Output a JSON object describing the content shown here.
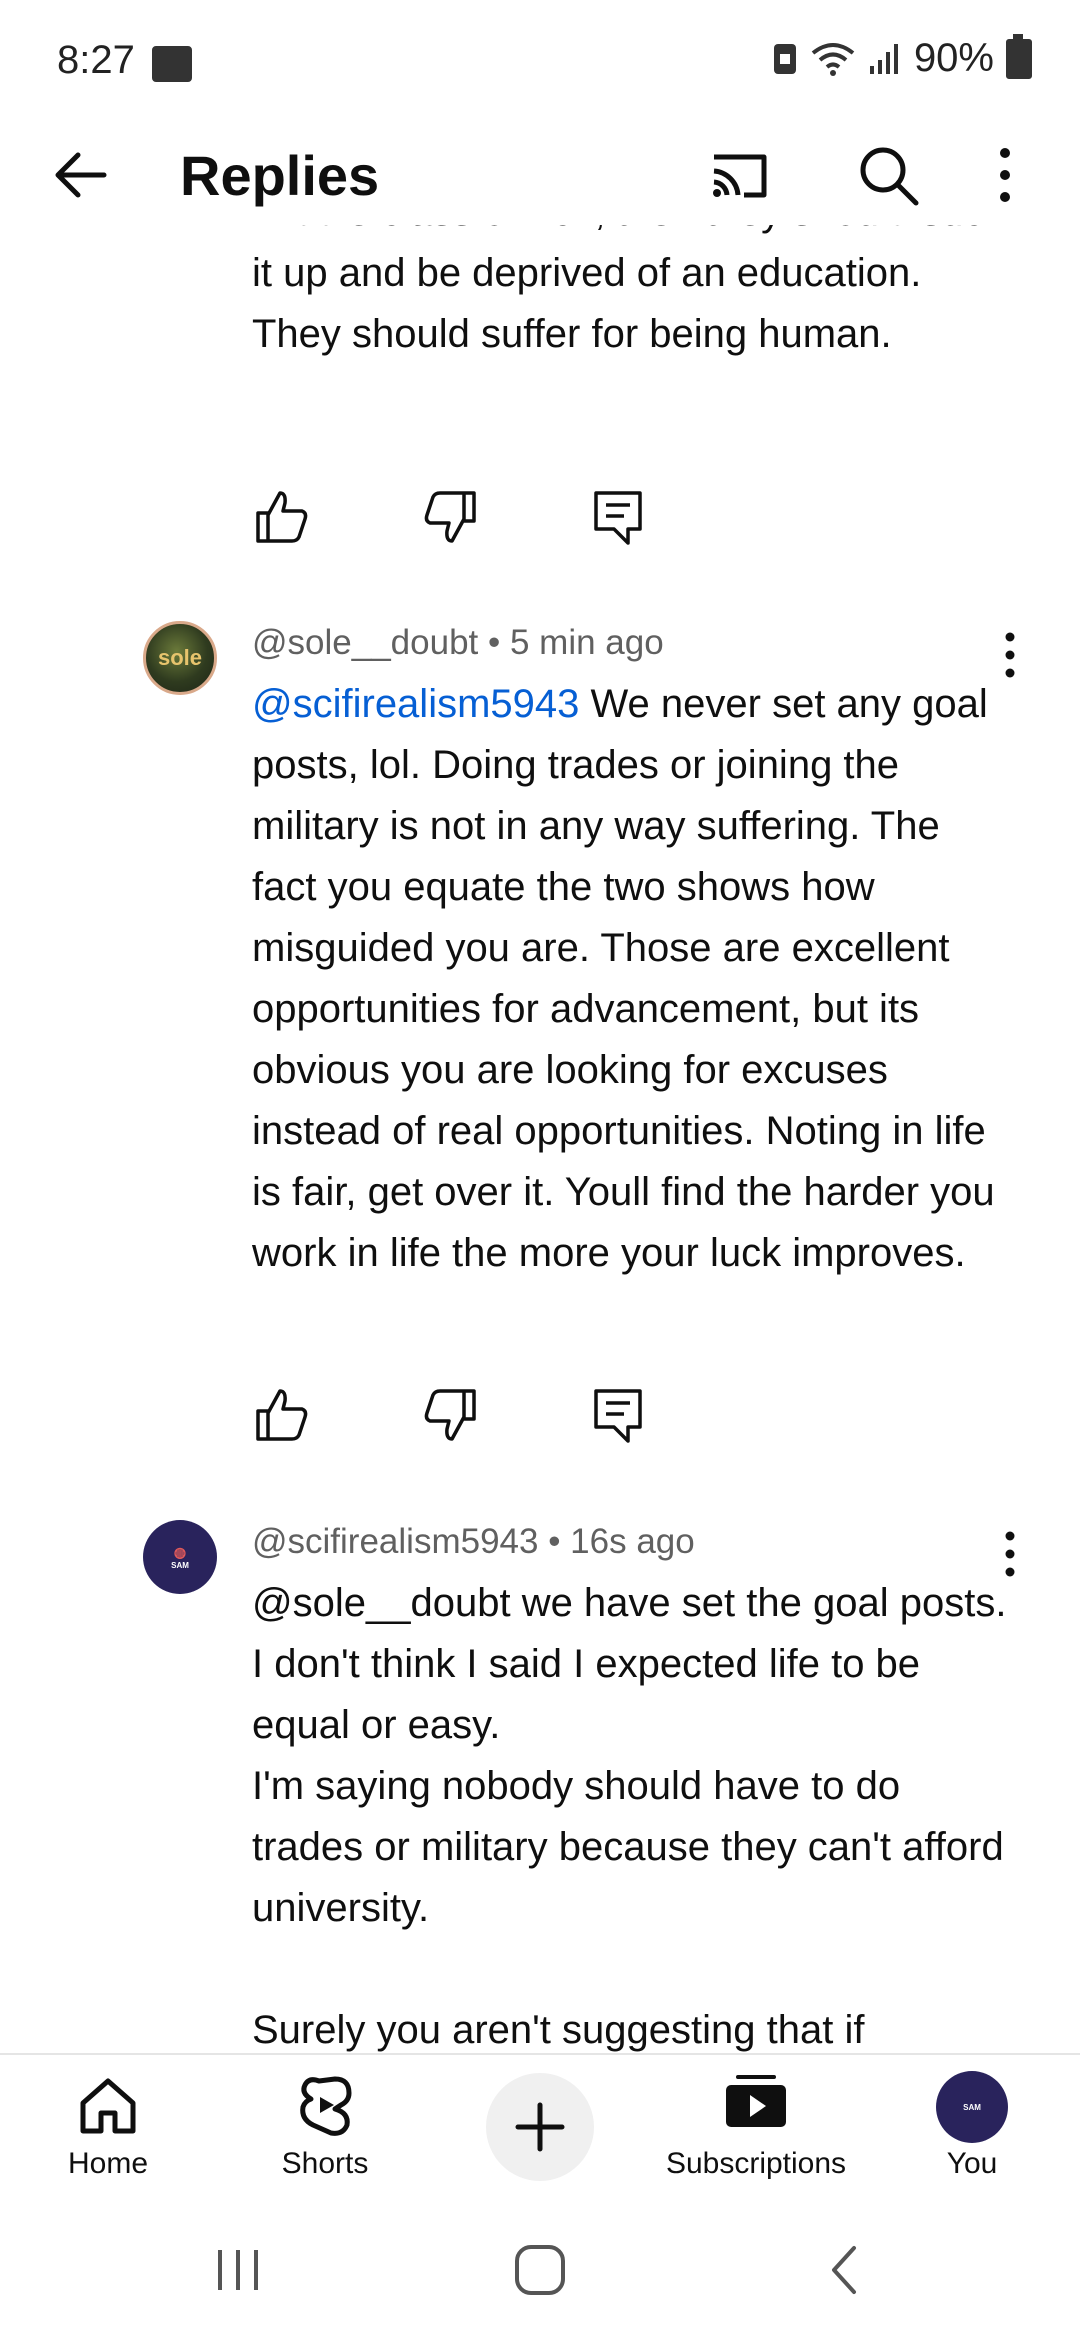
{
  "status_bar": {
    "time": "8:27",
    "battery": "90%"
  },
  "header": {
    "title": "Replies"
  },
  "partial_comment": {
    "text": "middle class or rich, then they should suck it up and be deprived of an education. They should suffer for being human."
  },
  "comments": [
    {
      "author": "@sole__doubt",
      "time": "5 min ago",
      "avatar_text": "sole",
      "mention": "@scifirealism5943",
      "text": "We never set any goal posts, lol.  Doing trades or joining the military is not in any way suffering.  The fact you equate the two shows how misguided you are.  Those are excellent opportunities for advancement, but its obvious you are looking for excuses instead of real opportunities.  Noting in life is fair, get over it.  Youll find the harder you work in life the more your luck improves."
    },
    {
      "author": "@scifirealism5943",
      "time": "16s ago",
      "avatar_text": "SAM",
      "text_lines": [
        "@sole__doubt  we have set the goal posts. I don't think I said I expected life to be equal or easy.",
        "I'm saying nobody should have to do trades or military because they can't afford university.",
        "",
        "Surely you aren't suggesting that if"
      ]
    }
  ],
  "separator": " • ",
  "bottom_nav": {
    "home": "Home",
    "shorts": "Shorts",
    "subscriptions": "Subscriptions",
    "you": "You",
    "you_avatar_text": "SAM"
  },
  "colors": {
    "accent_link": "#065fd4",
    "secondary_text": "#606060"
  }
}
